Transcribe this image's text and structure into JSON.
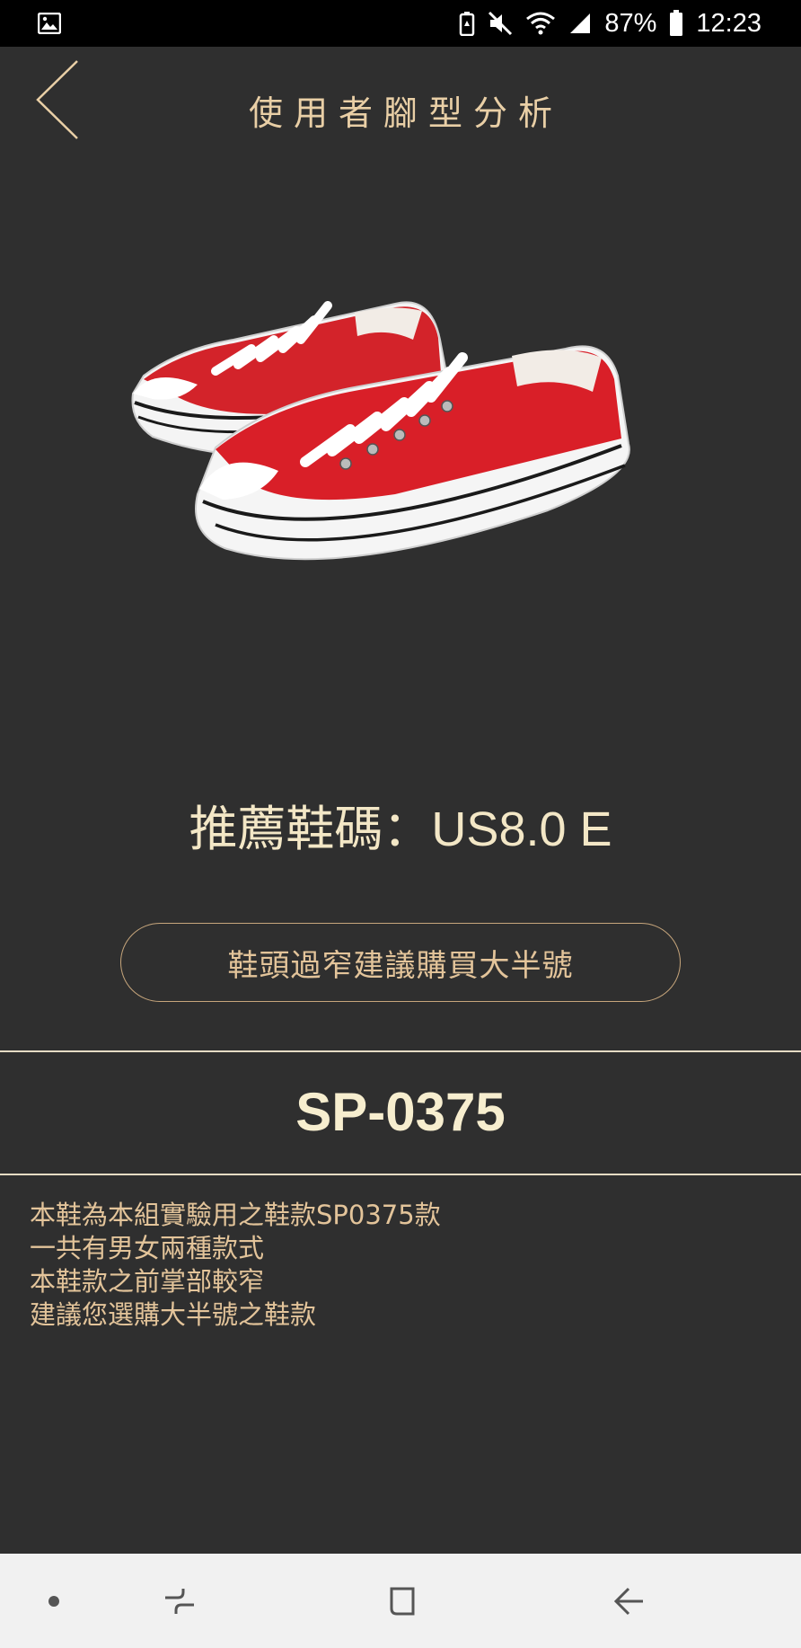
{
  "status_bar": {
    "battery": "87%",
    "time": "12:23",
    "icons": [
      "image-icon",
      "battery-saver-icon",
      "mute-icon",
      "wifi-icon",
      "signal-icon",
      "battery-icon"
    ]
  },
  "header": {
    "title": "使用者腳型分析",
    "back_icon": "chevron-left-icon"
  },
  "product": {
    "image_alt": "red-sneakers"
  },
  "recommendation": {
    "label": "推薦鞋碼：US8.0 E"
  },
  "advice": {
    "label": "鞋頭過窄建議購買大半號"
  },
  "model": {
    "code": "SP-0375"
  },
  "description": {
    "lines": [
      "本鞋為本組實驗用之鞋款SP0375款",
      "一共有男女兩種款式",
      "本鞋款之前掌部較窄",
      "建議您選購大半號之鞋款"
    ]
  },
  "nav_bar": {
    "icons": [
      "dot-icon",
      "recent-apps-icon",
      "home-icon",
      "back-icon"
    ]
  },
  "colors": {
    "background": "#2f2f2f",
    "accent": "#e9cfa6",
    "text_light": "#f3e7c6",
    "nav_background": "#f1f1f1"
  }
}
